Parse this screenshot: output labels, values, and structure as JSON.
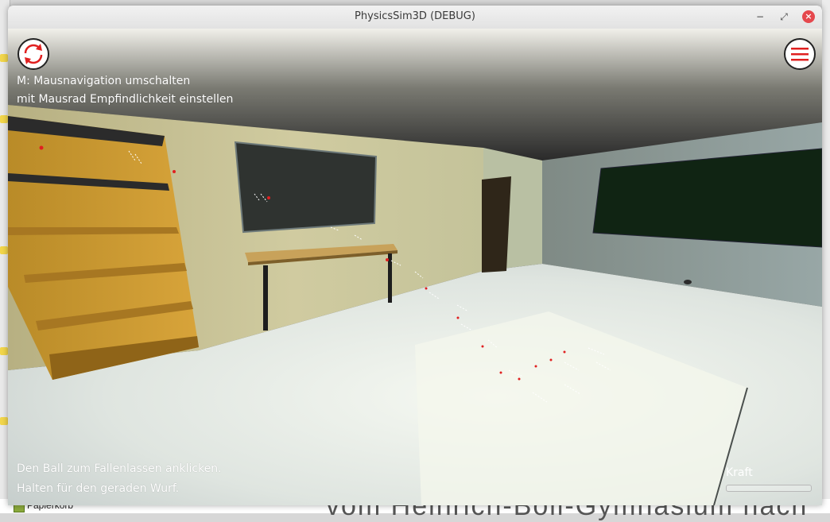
{
  "window": {
    "title": "PhysicsSim3D (DEBUG)",
    "controls": {
      "minimize": "−",
      "maximize": "⤢",
      "close": "×"
    }
  },
  "overlay": {
    "reset_icon": "refresh-icon",
    "menu_icon": "hamburger-menu-icon",
    "hint_top_line1": "M: Mausnavigation umschalten",
    "hint_top_line2": "mit Mausrad Empfindlichkeit einstellen",
    "hint_bottom_line1": "Den Ball zum Fallenlassen anklicken.",
    "hint_bottom_line2": "Halten für den geraden Wurf.",
    "force_label": "Kraft",
    "force_level": 0.0
  },
  "background": {
    "desktop_item": "Papierkorb",
    "document_text": "vom Heinrich-Böll-Gymnasium nach"
  },
  "colors": {
    "accent_red": "#e02020",
    "wall": "#c9c497",
    "ceiling": "#2c2c2c",
    "floor": "#e3e8df",
    "shelf": "#c9962e",
    "chalkboard": "#2c302b"
  }
}
